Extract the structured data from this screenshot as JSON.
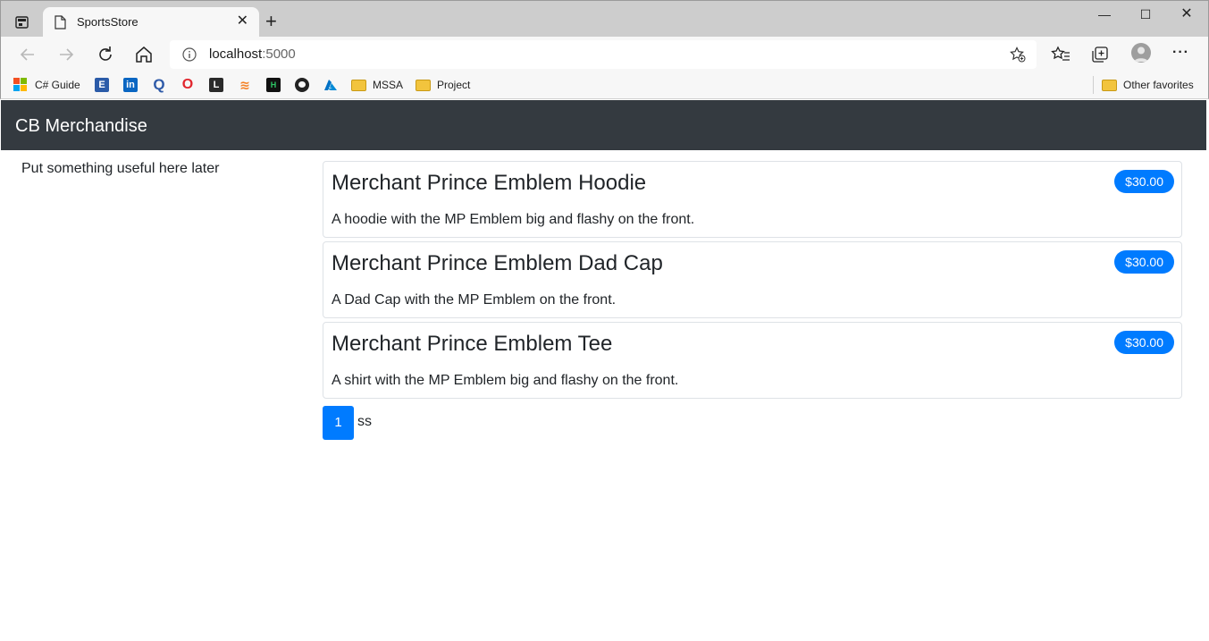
{
  "browser": {
    "tab_title": "SportsStore",
    "address_host": "localhost",
    "address_port": ":5000",
    "bookmarks": [
      {
        "label": "C# Guide",
        "icon": "microsoft-icon"
      },
      {
        "label": "",
        "icon": "e-icon"
      },
      {
        "label": "",
        "icon": "linkedin-icon"
      },
      {
        "label": "",
        "icon": "q-icon"
      },
      {
        "label": "",
        "icon": "opera-icon"
      },
      {
        "label": "",
        "icon": "l-icon"
      },
      {
        "label": "",
        "icon": "stackoverflow-icon"
      },
      {
        "label": "",
        "icon": "hackerrank-icon"
      },
      {
        "label": "",
        "icon": "github-icon"
      },
      {
        "label": "",
        "icon": "azure-icon"
      },
      {
        "label": "MSSA",
        "icon": "folder-icon"
      },
      {
        "label": "Project",
        "icon": "folder-icon"
      }
    ],
    "other_favorites": "Other favorites"
  },
  "site": {
    "brand": "CB Merchandise",
    "sidebar_text": "Put something useful here later",
    "products": [
      {
        "name": "Merchant Prince Emblem Hoodie",
        "price": "$30.00",
        "description": "A hoodie with the MP Emblem big and flashy on the front."
      },
      {
        "name": "Merchant Prince Emblem Dad Cap",
        "price": "$30.00",
        "description": "A Dad Cap with the MP Emblem on the front."
      },
      {
        "name": "Merchant Prince Emblem Tee",
        "price": "$30.00",
        "description": "A shirt with the MP Emblem big and flashy on the front."
      }
    ],
    "pagination": {
      "current_page": "1",
      "trailing_text": "ss"
    }
  },
  "colors": {
    "navbar": "#343a40",
    "accent": "#007bff"
  }
}
